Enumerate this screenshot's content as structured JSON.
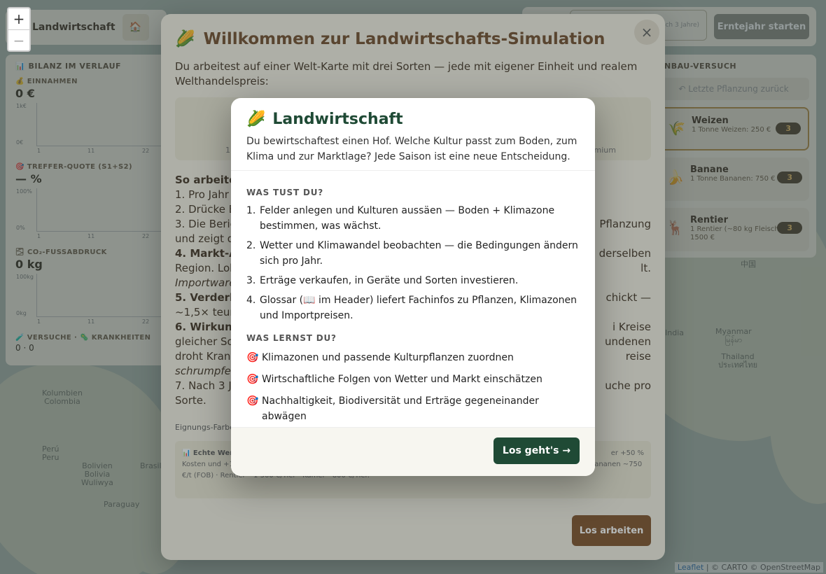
{
  "map": {
    "labels": [
      "Kolumbien\nColombia",
      "Perú\nPeru",
      "Bolivien\nBolivia\nWuliwya",
      "Paraguay",
      "Brasil",
      "Myanmar\nမြန်မာ",
      "Thailand\nประเทศไทย",
      "中国",
      "India"
    ],
    "attribution": {
      "leaflet": "Leaflet",
      "rest": " | © CARTO © OpenStreetMap"
    },
    "zoom_in": "+",
    "zoom_out": "−"
  },
  "app": {
    "brand": "Landwirtschaft",
    "home_icon": "🏠",
    "start_button": "Erntejahr starten",
    "year_button": "(noch 3 Jahre)"
  },
  "left_panel": {
    "title": "📊 BILANZ IM VERLAUF",
    "metrics": [
      {
        "label": "💰 EINNAHMEN",
        "value": "0 €",
        "ytop": "1k€",
        "ybot": "0€"
      },
      {
        "label": "🎯 TREFFER-QUOTE (S1+S2)",
        "value": "— %",
        "ytop": "100%",
        "ybot": "0%"
      },
      {
        "label": "🌫 CO₂-FUSSABDRUCK",
        "value": "0 kg",
        "ytop": "100kg",
        "ybot": "0kg"
      }
    ],
    "footer_label": "🧪 VERSUCHE · 🦠 KRANKHEITEN",
    "footer_value": "0 · 0",
    "x_ticks": [
      "1",
      "11",
      "22"
    ]
  },
  "right_panel": {
    "title": "ANBAU-VERSUCH",
    "undo": "↶ Letzte Pflanzung zurück",
    "crops": [
      {
        "icon": "🌾",
        "name": "Weizen",
        "desc": "1 Tonne Weizen: 250 €",
        "count": "3"
      },
      {
        "icon": "🍌",
        "name": "Banane",
        "desc": "1 Tonne Bananen: 750 €",
        "count": "3"
      },
      {
        "icon": "🦌",
        "name": "Rentier",
        "desc": "1 Rentier (~80 kg Fleisch): 1500 €",
        "count": "3"
      }
    ]
  },
  "welcome": {
    "icon": "🌽",
    "title": "Willkommen zur Landwirtschafts-Simulation",
    "intro": "Du arbeitest auf einer Welt-Karte mit drei Sorten — jede mit eigener Einheit und realem Welthandelspreis:",
    "card_left": "1",
    "card_right": "emium",
    "how_left": [
      "So arbeitest",
      "1. Pro Jahr",
      "2. Drücke E",
      "3. Die Beric",
      "und zeigt d",
      "4. Markt-A",
      "Region. Lok",
      "Importware",
      "5. Verderbl",
      "~1,5× teure",
      "6. Wirkung",
      "gleicher So",
      "droht Krank",
      "schrumpfen",
      "7. Nach 3 Ja",
      "Sorte."
    ],
    "how_right": [
      "",
      "",
      "",
      "Pflanzung",
      "",
      "derselben",
      "lt.",
      "",
      "chickt —",
      "",
      "i Kreise",
      "undenen",
      "reise",
      "",
      "uche pro",
      ""
    ],
    "legend": "Eignungs-Farbe",
    "infobox_title": "📊 Echte Wer",
    "infobox_text": "Kosten und +1 ... 022 (LKW 90 g/t-km · Schiff 10 g/t-km · Flieger 500 g/t-km). Welthandelspreise: Weizen ~250 €/t · Bananen ~750 €/t (FOB) · Rentier ~1 500 €/Tier · Kamel ~800 €/Tier.",
    "infobox_right": "er +50 %",
    "close": "×",
    "go_button": "Los arbeiten"
  },
  "modal": {
    "icon": "🌽",
    "title": "Landwirtschaft",
    "subtitle": "Du bewirtschaftest einen Hof. Welche Kultur passt zum Boden, zum Klima und zur Marktlage? Jede Saison ist eine neue Entscheidung.",
    "section1": "WAS TUST DU?",
    "steps": [
      {
        "n": "1.",
        "text": "Felder anlegen und Kulturen aussäen — Boden + Klimazone bestimmen, was wächst."
      },
      {
        "n": "2.",
        "text": "Wetter und Klimawandel beobachten — die Bedingungen ändern sich pro Jahr."
      },
      {
        "n": "3.",
        "text": "Erträge verkaufen, in Geräte und Sorten investieren."
      },
      {
        "n": "4.",
        "text": "Glossar (📖 im Header) liefert Fachinfos zu Pflanzen, Klimazonen und Importpreisen."
      }
    ],
    "section2": "WAS LERNST DU?",
    "goal_icon": "🎯",
    "goals": [
      "Klimazonen und passende Kulturpflanzen zuordnen",
      "Wirtschaftliche Folgen von Wetter und Markt einschätzen",
      "Nachhaltigkeit, Biodiversität und Erträge gegeneinander abwägen"
    ],
    "go_button": "Los geht's →"
  }
}
